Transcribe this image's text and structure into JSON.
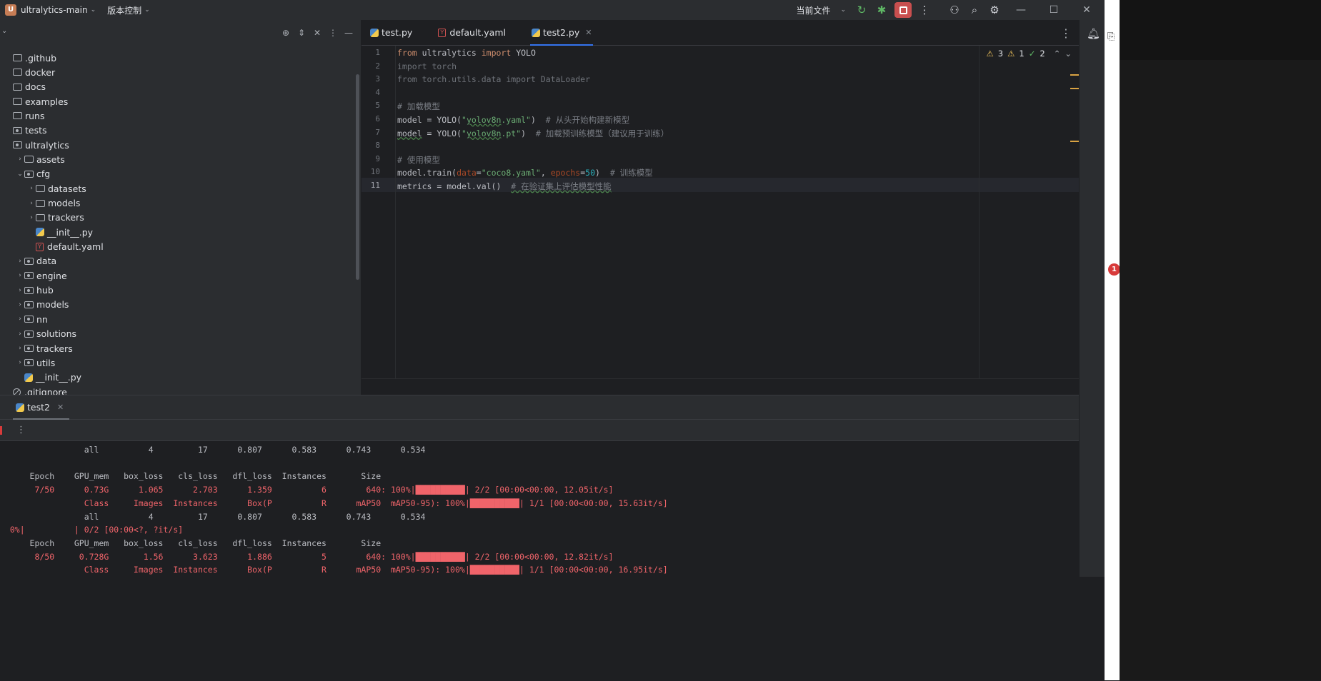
{
  "titlebar": {
    "project_badge": "U",
    "project_name": "ultralytics-main",
    "vcs": "版本控制",
    "run_config": "当前文件"
  },
  "project_tree": {
    "root_label": "ultralytics-main",
    "items": [
      {
        "label": ".github",
        "kind": "folder",
        "indent": 0,
        "caret": ""
      },
      {
        "label": "docker",
        "kind": "folder",
        "indent": 0,
        "caret": ""
      },
      {
        "label": "docs",
        "kind": "folder",
        "indent": 0,
        "caret": ""
      },
      {
        "label": "examples",
        "kind": "folder",
        "indent": 0,
        "caret": ""
      },
      {
        "label": "runs",
        "kind": "folder",
        "indent": 0,
        "caret": ""
      },
      {
        "label": "tests",
        "kind": "pkg",
        "indent": 0,
        "caret": ""
      },
      {
        "label": "ultralytics",
        "kind": "pkg",
        "indent": 0,
        "caret": ""
      },
      {
        "label": "assets",
        "kind": "folder",
        "indent": 1,
        "caret": "›"
      },
      {
        "label": "cfg",
        "kind": "pkg",
        "indent": 1,
        "caret": "⌄"
      },
      {
        "label": "datasets",
        "kind": "folder",
        "indent": 2,
        "caret": "›"
      },
      {
        "label": "models",
        "kind": "folder",
        "indent": 2,
        "caret": "›"
      },
      {
        "label": "trackers",
        "kind": "folder",
        "indent": 2,
        "caret": "›"
      },
      {
        "label": "__init__.py",
        "kind": "py",
        "indent": 2,
        "caret": ""
      },
      {
        "label": "default.yaml",
        "kind": "yaml",
        "indent": 2,
        "caret": ""
      },
      {
        "label": "data",
        "kind": "pkg",
        "indent": 1,
        "caret": "›"
      },
      {
        "label": "engine",
        "kind": "pkg",
        "indent": 1,
        "caret": "›"
      },
      {
        "label": "hub",
        "kind": "pkg",
        "indent": 1,
        "caret": "›"
      },
      {
        "label": "models",
        "kind": "pkg",
        "indent": 1,
        "caret": "›"
      },
      {
        "label": "nn",
        "kind": "pkg",
        "indent": 1,
        "caret": "›"
      },
      {
        "label": "solutions",
        "kind": "pkg",
        "indent": 1,
        "caret": "›"
      },
      {
        "label": "trackers",
        "kind": "pkg",
        "indent": 1,
        "caret": "›"
      },
      {
        "label": "utils",
        "kind": "pkg",
        "indent": 1,
        "caret": "›"
      },
      {
        "label": "__init__.py",
        "kind": "py",
        "indent": 1,
        "caret": ""
      },
      {
        "label": ".gitignore",
        "kind": "git",
        "indent": 0,
        "caret": ""
      }
    ]
  },
  "editor": {
    "tabs": [
      {
        "label": "test.py",
        "icon": "python-file-icon",
        "active": false
      },
      {
        "label": "default.yaml",
        "icon": "yaml-file-icon",
        "active": false
      },
      {
        "label": "test2.py",
        "icon": "python-file-icon",
        "active": true
      }
    ],
    "inspections": {
      "warnings": "3",
      "weak_warnings": "1",
      "ok": "2"
    },
    "current_line": 11,
    "lines": [
      [
        {
          "t": "from ",
          "c": "kw"
        },
        {
          "t": "ultralytics ",
          "c": ""
        },
        {
          "t": "import ",
          "c": "kw"
        },
        {
          "t": "YOLO",
          "c": ""
        }
      ],
      [
        {
          "t": "import torch",
          "c": "dim"
        }
      ],
      [
        {
          "t": "from torch.utils.data import DataLoader",
          "c": "dim"
        }
      ],
      [],
      [
        {
          "t": "# 加载模型",
          "c": "cm"
        }
      ],
      [
        {
          "t": "model = YOLO(",
          "c": ""
        },
        {
          "t": "\"",
          "c": "str"
        },
        {
          "t": "yolov8n",
          "c": "str wavy"
        },
        {
          "t": ".yaml\"",
          "c": "str"
        },
        {
          "t": ")  ",
          "c": ""
        },
        {
          "t": "# 从头开始构建新模型",
          "c": "cm"
        }
      ],
      [
        {
          "t": "model",
          "c": "wavy"
        },
        {
          "t": " = YOLO(",
          "c": ""
        },
        {
          "t": "\"",
          "c": "str"
        },
        {
          "t": "yolov8n",
          "c": "str wavy"
        },
        {
          "t": ".pt\"",
          "c": "str"
        },
        {
          "t": ")  ",
          "c": ""
        },
        {
          "t": "# 加载预训练模型（建议用于训练）",
          "c": "cm"
        }
      ],
      [],
      [
        {
          "t": "# 使用模型",
          "c": "cm"
        }
      ],
      [
        {
          "t": "model.train(",
          "c": ""
        },
        {
          "t": "data",
          "c": "param"
        },
        {
          "t": "=",
          "c": ""
        },
        {
          "t": "\"coco8.yaml\"",
          "c": "str"
        },
        {
          "t": ", ",
          "c": ""
        },
        {
          "t": "epochs",
          "c": "param"
        },
        {
          "t": "=",
          "c": ""
        },
        {
          "t": "50",
          "c": "num"
        },
        {
          "t": ")  ",
          "c": ""
        },
        {
          "t": "# 训练模型",
          "c": "cm"
        }
      ],
      [
        {
          "t": "metrics = model.val()  ",
          "c": ""
        },
        {
          "t": "# 在验证集上评估模型性能",
          "c": "cm wavy"
        }
      ]
    ]
  },
  "run_panel": {
    "tab_label": "test2",
    "console_lines": [
      {
        "text": "                 all          4         17      0.807      0.583      0.743      0.534",
        "color": "w"
      },
      {
        "text": "",
        "color": "w"
      },
      {
        "text": "      Epoch    GPU_mem   box_loss   cls_loss   dfl_loss  Instances       Size",
        "color": "w"
      },
      {
        "text": "       7/50      0.73G      1.065      2.703      1.359          6        640: 100%|██████████| 2/2 [00:00<00:00, 12.05it/s]",
        "color": "r"
      },
      {
        "text": "                 Class     Images  Instances      Box(P          R      mAP50  mAP50-95): 100%|██████████| 1/1 [00:00<00:00, 15.63it/s]",
        "color": "r"
      },
      {
        "text": "                 all          4         17      0.807      0.583      0.743      0.534",
        "color": "w"
      },
      {
        "text": "  0%|          | 0/2 [00:00<?, ?it/s]",
        "color": "r"
      },
      {
        "text": "      Epoch    GPU_mem   box_loss   cls_loss   dfl_loss  Instances       Size",
        "color": "w"
      },
      {
        "text": "       8/50     0.728G       1.56      3.623      1.886          5        640: 100%|██████████| 2/2 [00:00<00:00, 12.82it/s]",
        "color": "r"
      },
      {
        "text": "                 Class     Images  Instances      Box(P          R      mAP50  mAP50-95): 100%|██████████| 1/1 [00:00<00:00, 16.95it/s]",
        "color": "r"
      }
    ]
  },
  "notifications_badge": "1",
  "colors": {
    "accent": "#3574f0",
    "stop_button": "#c94f4f",
    "console_error": "#f0646a",
    "warning": "#f2c55c"
  }
}
